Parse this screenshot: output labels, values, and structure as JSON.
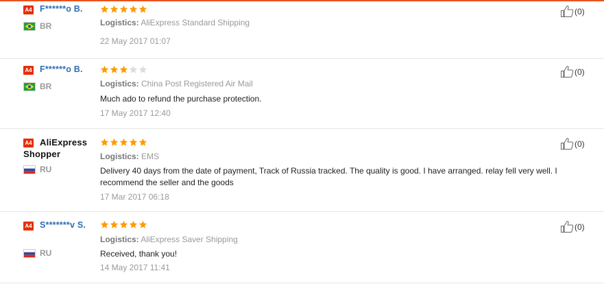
{
  "reviews": [
    {
      "badge": "A4",
      "username": "F******o B.",
      "country": "BR",
      "flag": "brazil",
      "rating": 5,
      "logistics_label": "Logistics:",
      "logistics": "AliExpress Standard Shipping",
      "feedback": "",
      "date": "22 May 2017 01:07",
      "helpful_count": "(0)"
    },
    {
      "badge": "A4",
      "username": "F******o B.",
      "country": "BR",
      "flag": "brazil",
      "rating": 3,
      "logistics_label": "Logistics:",
      "logistics": "China Post Registered Air Mail",
      "feedback": "Much ado to refund the purchase protection.",
      "date": "17 May 2017 12:40",
      "helpful_count": "(0)"
    },
    {
      "badge": "A4",
      "username": "AliExpress Shopper",
      "country": "RU",
      "flag": "russia",
      "rating": 5,
      "logistics_label": "Logistics:",
      "logistics": "EMS",
      "feedback": "Delivery 40 days from the date of payment, Track of Russia tracked. The quality is good. I have arranged. relay fell very well. I recommend the seller and the goods",
      "date": "17 Mar 2017 06:18",
      "helpful_count": "(0)"
    },
    {
      "badge": "A4",
      "username": "S*******v S.",
      "country": "RU",
      "flag": "russia",
      "rating": 5,
      "logistics_label": "Logistics:",
      "logistics": "AliExpress Saver Shipping",
      "feedback": "Received, thank you!",
      "date": "14 May 2017 11:41",
      "helpful_count": "(0)"
    }
  ],
  "colors": {
    "accent": "#e8541e",
    "star_filled": "#ff9b00",
    "star_empty": "#dddddd",
    "username": "#2f6db5"
  },
  "icons": [
    "level-badge-icon",
    "flag-icon",
    "star-icon",
    "thumbs-up-icon"
  ]
}
